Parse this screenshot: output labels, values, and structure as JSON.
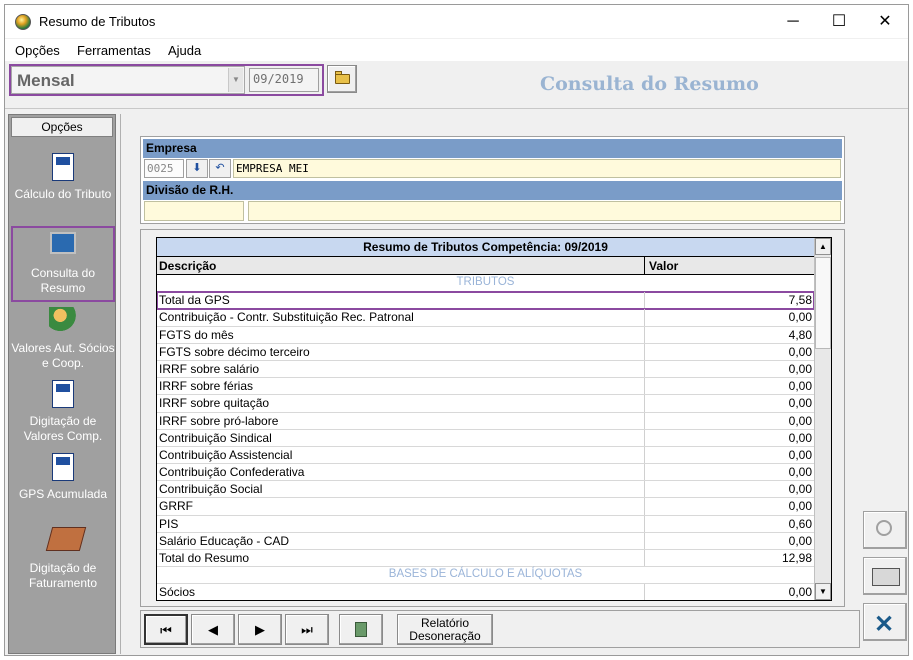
{
  "window": {
    "title": "Resumo de Tributos",
    "minimize": "─",
    "maximize": "☐",
    "close": "✕"
  },
  "menu": [
    "Opções",
    "Ferramentas",
    "Ajuda"
  ],
  "toolbar": {
    "period_value": "Mensal",
    "date_value": "09/2019",
    "heading": "Consulta do Resumo"
  },
  "sidebar": {
    "header": "Opções",
    "items": [
      {
        "label": "Cálculo do Tributo",
        "icon": "calc-document-icon"
      },
      {
        "label": "Consulta do Resumo",
        "icon": "monitor-query-icon",
        "selected": true
      },
      {
        "label": "Valores Aut. Sócios e Coop.",
        "icon": "people-money-icon"
      },
      {
        "label": "Digitação de Valores Comp.",
        "icon": "edit-document-icon"
      },
      {
        "label": "GPS Acumulada",
        "icon": "gps-document-icon"
      },
      {
        "label": "Digitação de Faturamento",
        "icon": "keyboard-icon"
      }
    ]
  },
  "empresa": {
    "label": "Empresa",
    "code": "0025",
    "name": "EMPRESA MEI",
    "divisao_label": "Divisão de R.H."
  },
  "grid": {
    "title": "Resumo de Tributos Competência: 09/2019",
    "col_desc": "Descrição",
    "col_val": "Valor",
    "rows": [
      {
        "type": "section",
        "desc": "TRIBUTOS"
      },
      {
        "desc": "Total da GPS",
        "val": "7,58",
        "highlight": true
      },
      {
        "desc": "Contribuição - Contr. Substituição Rec. Patronal",
        "val": "0,00"
      },
      {
        "desc": "FGTS do mês",
        "val": "4,80"
      },
      {
        "desc": "FGTS sobre décimo terceiro",
        "val": "0,00"
      },
      {
        "desc": "IRRF sobre salário",
        "val": "0,00"
      },
      {
        "desc": "IRRF sobre férias",
        "val": "0,00"
      },
      {
        "desc": "IRRF sobre quitação",
        "val": "0,00"
      },
      {
        "desc": "IRRF sobre pró-labore",
        "val": "0,00"
      },
      {
        "desc": "Contribuição Sindical",
        "val": "0,00"
      },
      {
        "desc": "Contribuição Assistencial",
        "val": "0,00"
      },
      {
        "desc": "Contribuição Confederativa",
        "val": "0,00"
      },
      {
        "desc": "Contribuição Social",
        "val": "0,00"
      },
      {
        "desc": "GRRF",
        "val": "0,00"
      },
      {
        "desc": "PIS",
        "val": "0,60"
      },
      {
        "desc": "Salário Educação - CAD",
        "val": "0,00"
      },
      {
        "desc": "Total do Resumo",
        "val": "12,98"
      },
      {
        "type": "section",
        "desc": "BASES DE CÁLCULO E ALÍQUOTAS"
      },
      {
        "desc": "Sócios",
        "val": "0,00"
      }
    ]
  },
  "nav": {
    "first": "⏮",
    "prev": "◀",
    "next": "▶",
    "last": "⏭",
    "relatorio": "Relatório Desoneração"
  }
}
